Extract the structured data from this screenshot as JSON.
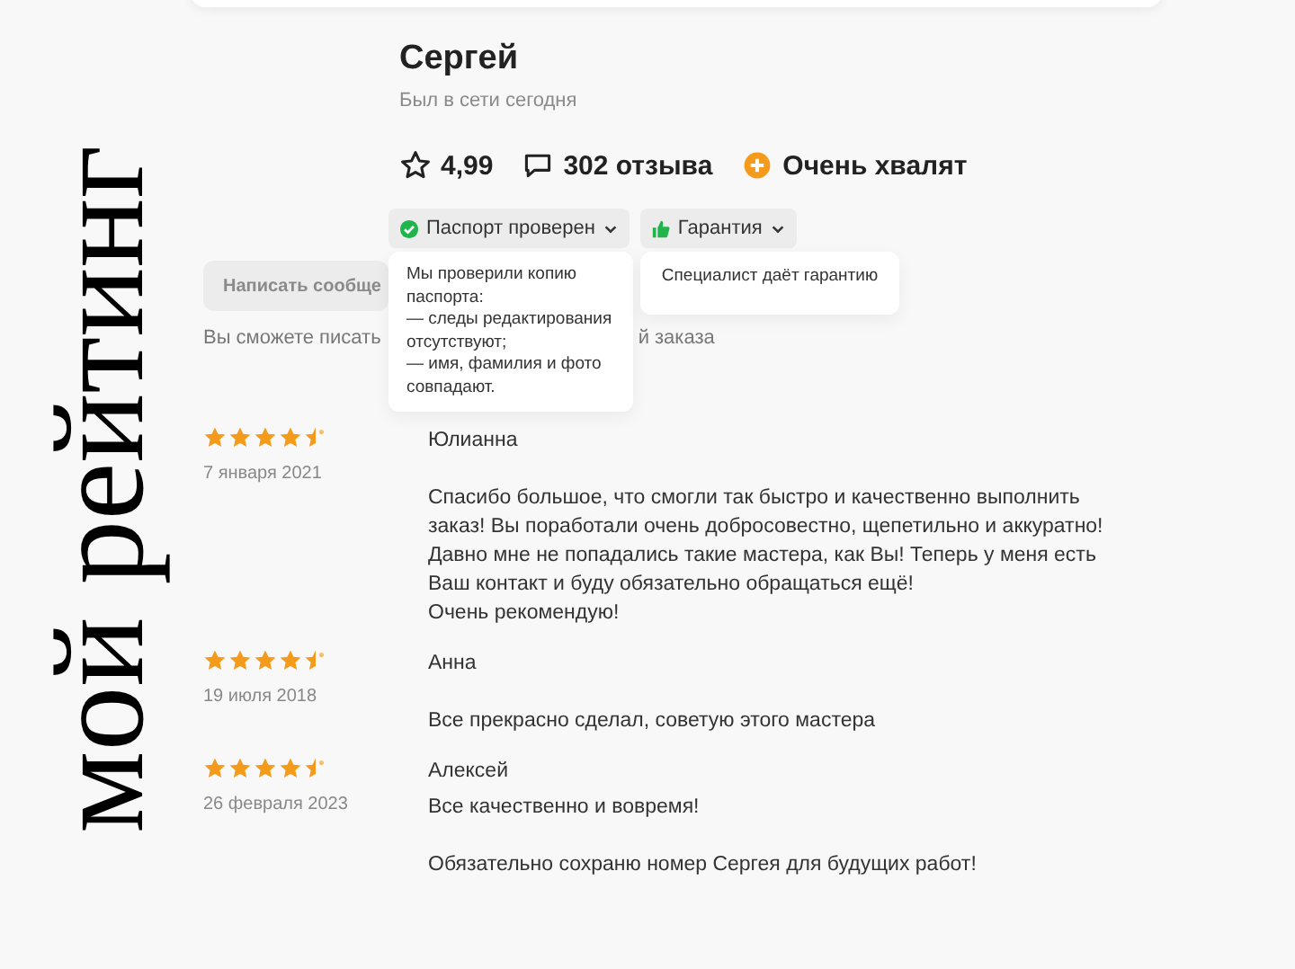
{
  "overlay_caption": "мой рейтинг",
  "profile": {
    "name": "Сергей",
    "status": "Был в сети сегодня",
    "rating": "4,99",
    "reviews_count": "302 отзыва",
    "badge": "Очень хвалят"
  },
  "chips": [
    {
      "label": "Паспорт проверен",
      "kind": "check",
      "expanded": true,
      "popover": "Мы проверили копию паспорта:\n— следы редактирования отсутствуют;\n— имя, фамилия и фото совпадают."
    },
    {
      "label": "Гарантия",
      "kind": "thumb",
      "expanded": true,
      "popover": "Специалист даёт гарантию"
    }
  ],
  "message_button": "Написать сообще",
  "hint_parts": [
    "Вы сможете писать",
    "й заказа"
  ],
  "reviews": [
    {
      "author": "Юлианна",
      "date": "7 января 2021",
      "stars": 4.5,
      "text": "Спасибо большое, что смогли так быстро и качественно выполнить\nзаказ! Вы поработали очень добросовестно, щепетильно и аккуратно!\nДавно мне не попадались такие мастера, как Вы! Теперь у меня есть\nВаш контакт и буду обязательно обращаться ещё!\nОчень рекомендую!"
    },
    {
      "author": "Анна",
      "date": "19 июля 2018",
      "stars": 4.5,
      "text": "Все прекрасно сделал, советую этого мастера"
    },
    {
      "author": "Алексей",
      "date": "26 февраля 2023",
      "stars": 4.5,
      "text": "Все качественно и вовремя!\n\nОбязательно сохраню номер Сергея для будущих работ!"
    }
  ]
}
